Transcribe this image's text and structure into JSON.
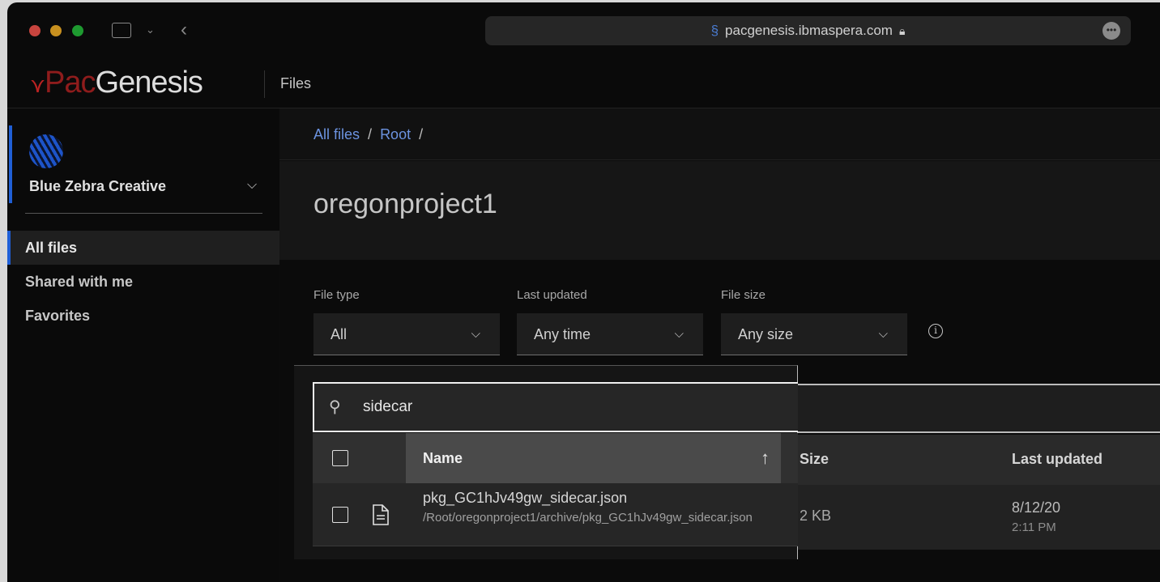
{
  "browser": {
    "url": "pacgenesis.ibmaspera.com",
    "traffic_lights": [
      "#e0443e",
      "#dea123",
      "#1aab29"
    ]
  },
  "header": {
    "logo_part1": "Pac",
    "logo_part2": "Genesis",
    "section": "Files"
  },
  "sidebar": {
    "account": "Blue Zebra Creative",
    "items": [
      {
        "label": "All files",
        "active": true
      },
      {
        "label": "Shared with me"
      },
      {
        "label": "Favorites"
      }
    ]
  },
  "breadcrumb": {
    "items": [
      "All files",
      "Root"
    ],
    "separator": "/"
  },
  "page": {
    "title": "oregonproject1"
  },
  "filters": [
    {
      "label": "File type",
      "value": "All"
    },
    {
      "label": "Last updated",
      "value": "Any time"
    },
    {
      "label": "File size",
      "value": "Any size"
    }
  ],
  "search": {
    "value": "sidecar"
  },
  "table": {
    "columns": {
      "name": "Name",
      "size": "Size",
      "updated": "Last updated"
    },
    "rows": [
      {
        "name": "pkg_GC1hJv49gw_sidecar.json",
        "path": "/Root/oregonproject1/archive/pkg_GC1hJv49gw_sidecar.json",
        "size": "2 KB",
        "date": "8/12/20",
        "time": "2:11 PM"
      }
    ]
  },
  "colors": {
    "accent": "#1f5fd6",
    "link": "#6c93e0",
    "brand_red": "#8f1c1c"
  }
}
